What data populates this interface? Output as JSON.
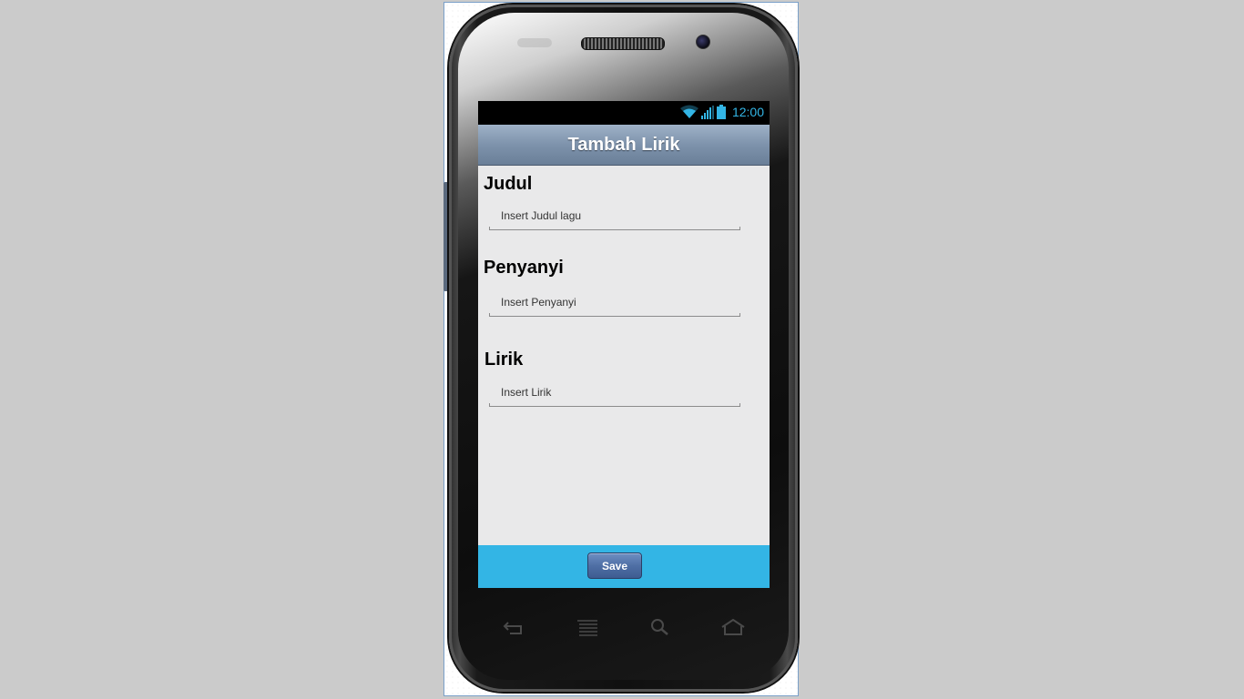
{
  "statusbar": {
    "time": "12:00",
    "icons": [
      "wifi-icon",
      "signal-icon",
      "battery-icon"
    ]
  },
  "app": {
    "title": "Tambah Lirik"
  },
  "form": {
    "judul_label": "Judul",
    "judul_placeholder": "Insert Judul lagu",
    "penyanyi_label": "Penyanyi",
    "penyanyi_placeholder": "Insert Penyanyi",
    "lirik_label": "Lirik",
    "lirik_placeholder": "Insert Lirik"
  },
  "footer": {
    "save_label": "Save"
  },
  "navbar": {
    "keys": [
      "back-icon",
      "menu-icon",
      "search-icon",
      "home-icon"
    ]
  },
  "colors": {
    "accent": "#33b5e5",
    "header": "#7d92ab",
    "button": "#4f6fa5",
    "background": "#e9e9ea"
  }
}
